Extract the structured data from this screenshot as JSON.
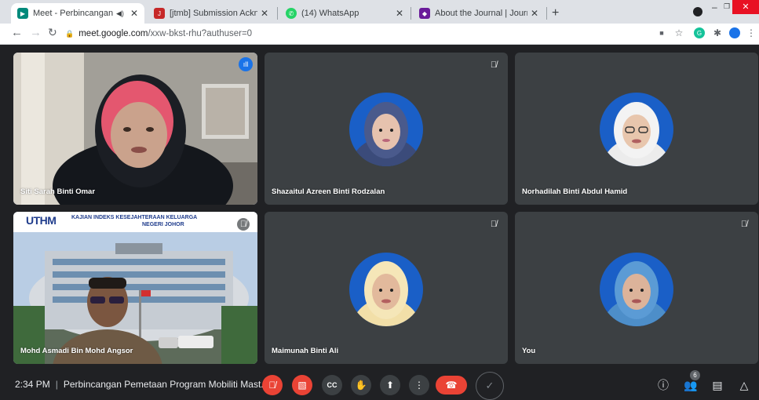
{
  "browser": {
    "tabs": [
      {
        "title": "Meet - Perbincangan Pemeta",
        "color": "#00897b",
        "audio": true
      },
      {
        "title": "[jtmb] Submission Acknowledgem",
        "color": "#c62828"
      },
      {
        "title": "(14) WhatsApp",
        "color": "#25d366"
      },
      {
        "title": "About the Journal | Journal of Tec",
        "color": "#6a1b9a"
      }
    ],
    "new_tab": "+",
    "url_host": "meet.google.com",
    "url_path": "/xxw-bkst-rhu?authuser=0",
    "window_close": "✕",
    "window_min": "–",
    "window_restore": "❐"
  },
  "participants": [
    {
      "name": "Siti Sarah Binti Omar",
      "muted": false,
      "speaking": true,
      "video": "camera"
    },
    {
      "name": "Shazaitul Azreen Binti Rodzalan",
      "muted": true,
      "video": "avatar",
      "avatar_bg": "#1a5fc7",
      "hijab": "#4a5a8c"
    },
    {
      "name": "Norhadilah Binti Abdul Hamid",
      "muted": false,
      "video": "avatar",
      "avatar_bg": "#1a5fc7",
      "hijab": "#f3f3f3"
    },
    {
      "name": "Mohd Asmadi Bin Mohd Angsor",
      "muted": true,
      "video": "camera",
      "banner": "UTHM",
      "banner_text": "KAJIAN INDEKS KESEJAHTERAAN KELUARGA",
      "banner_text2": "NEGERI JOHOR"
    },
    {
      "name": "Maimunah Binti Ali",
      "muted": true,
      "video": "avatar",
      "avatar_bg": "#1a5fc7",
      "hijab": "#f5e6b8"
    },
    {
      "name": "You",
      "muted": true,
      "video": "avatar",
      "avatar_bg": "#1a5fc7",
      "hijab": "#5b9bd5"
    }
  ],
  "meeting": {
    "time": "2:34 PM",
    "separator": "|",
    "title": "Perbincangan Pemetaan Program Mobiliti Mast..."
  },
  "people_count": "6",
  "colors": {
    "accent": "#8ab4f8",
    "danger": "#ea4335",
    "surface": "#3c4043"
  }
}
